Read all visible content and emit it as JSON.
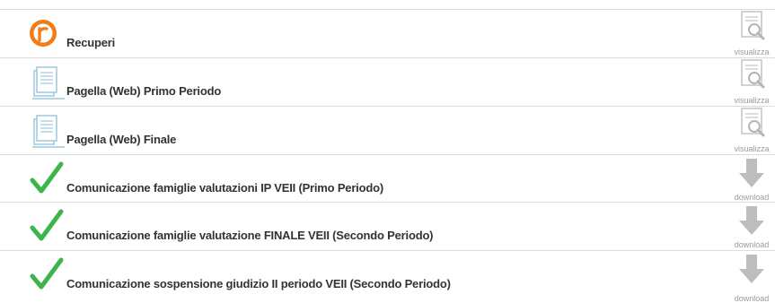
{
  "rows": [
    {
      "icon": "recuperi-icon",
      "label": "Recuperi",
      "action": "visualizza",
      "action_icon": "magnifier-document-icon"
    },
    {
      "icon": "document-icon",
      "label": "Pagella (Web) Primo Periodo",
      "action": "visualizza",
      "action_icon": "magnifier-document-icon"
    },
    {
      "icon": "document-icon",
      "label": "Pagella (Web) Finale",
      "action": "visualizza",
      "action_icon": "magnifier-document-icon"
    },
    {
      "icon": "checkmark-icon",
      "label": "Comunicazione famiglie valutazioni IP VEII (Primo Periodo)",
      "action": "download",
      "action_icon": "download-arrow-icon"
    },
    {
      "icon": "checkmark-icon",
      "label": "Comunicazione famiglie valutazione FINALE VEII (Secondo Periodo)",
      "action": "download",
      "action_icon": "download-arrow-icon"
    },
    {
      "icon": "checkmark-icon",
      "label": "Comunicazione sospensione giudizio II periodo VEII (Secondo Periodo)",
      "action": "download",
      "action_icon": "download-arrow-icon"
    }
  ],
  "colors": {
    "recuperi_orange": "#f07d16",
    "check_green": "#3cb54a",
    "doc_blue": "#9ec7df",
    "action_gray": "#bdbdbd"
  }
}
